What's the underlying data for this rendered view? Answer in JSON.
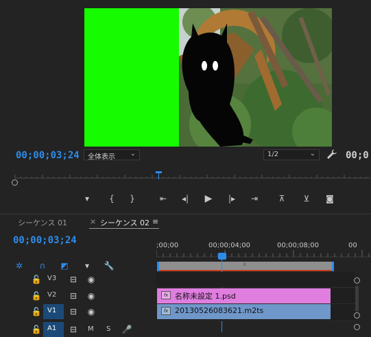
{
  "program_monitor": {
    "timecode": "00;00;03;24",
    "fit_label": "全体表示",
    "resolution_label": "1/2",
    "duration_timecode": "00;0"
  },
  "controls": {
    "marker": "marker-icon",
    "in": "mark-in-icon",
    "out": "mark-out-icon",
    "go_in": "go-to-in-icon",
    "step_back": "step-back-icon",
    "play": "play-icon",
    "step_fwd": "step-forward-icon",
    "go_out": "go-to-out-icon",
    "lift": "lift-icon",
    "extract": "extract-icon",
    "export_frame": "camera-icon"
  },
  "timeline": {
    "tabs": [
      "シーケンス 01",
      "シーケンス 02"
    ],
    "active_tab": 1,
    "close_mark": "×",
    "menu_mark": "≡",
    "timecode": "00;00;03;24",
    "ruler_labels": [
      ";00;00",
      "00;00;04;00",
      "00;00;08;00",
      "00"
    ],
    "tracks": [
      {
        "name": "V3",
        "label": "V3"
      },
      {
        "name": "V2",
        "label": "V2"
      },
      {
        "name": "V1",
        "label": "V1"
      },
      {
        "name": "A1",
        "label": "A1",
        "m": "M",
        "s": "S"
      }
    ],
    "clips": [
      {
        "track": "V2",
        "name": "名称未設定 1.psd",
        "color": "#e07ee0"
      },
      {
        "track": "V1",
        "name": "20130526083621.m2ts",
        "color": "#6f97c9"
      }
    ],
    "fx_badge": "fx",
    "workarea_mark": "II"
  }
}
